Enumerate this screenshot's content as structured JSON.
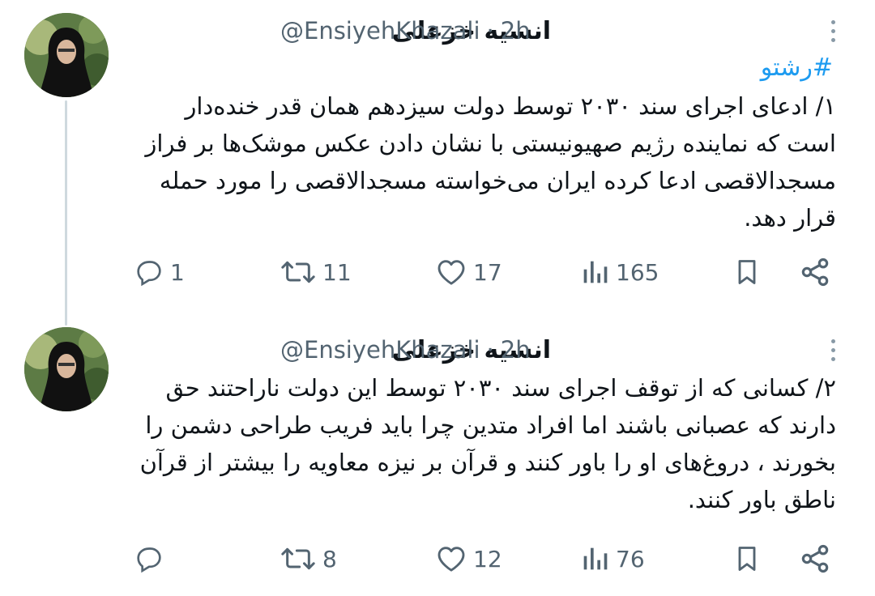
{
  "tweets": [
    {
      "author": {
        "display_name": "انسیه خزعلی",
        "handle": "@EnsiyehKhazali",
        "separator": "·",
        "time": "2h"
      },
      "hashtag": "#رشتو",
      "lines": [
        "۱/ ادعای اجرای سند ۲۰۳۰ توسط دولت سیزدهم همان قدر خنده‌دار",
        "است که نماینده رژیم صهیونیستی با نشان دادن عکس موشک‌ها بر فراز",
        "مسجدالاقصی ادعا کرده ایران می‌خواسته مسجدالاقصی را مورد حمله",
        "قرار دهد."
      ],
      "stats": {
        "replies": "1",
        "retweets": "11",
        "likes": "17",
        "views": "165"
      },
      "icons": [
        "more-icon",
        "reply-icon",
        "retweet-icon",
        "like-icon",
        "views-icon",
        "bookmark-icon",
        "share-icon"
      ]
    },
    {
      "author": {
        "display_name": "انسیه خزعلی",
        "handle": "@EnsiyehKhazali",
        "separator": "·",
        "time": "2h"
      },
      "hashtag": "",
      "lines": [
        "۲/ کسانی که از توقف اجرای سند ۲۰۳۰ توسط این دولت ناراحتند حق",
        "دارند که عصبانی باشند اما افراد متدین چرا باید فریب طراحی دشمن را",
        "بخورند ، دروغ‌های او را باور کنند و قرآن بر نیزه معاویه را بیشتر از قرآن",
        "ناطق باور کنند."
      ],
      "stats": {
        "replies": "",
        "retweets": "8",
        "likes": "12",
        "views": "76"
      },
      "icons": [
        "more-icon",
        "reply-icon",
        "retweet-icon",
        "like-icon",
        "views-icon",
        "bookmark-icon",
        "share-icon"
      ]
    }
  ],
  "colors": {
    "text": "#0f1419",
    "secondary": "#536471",
    "accent": "#1d9bf0",
    "thread_line": "#cfd9de"
  }
}
